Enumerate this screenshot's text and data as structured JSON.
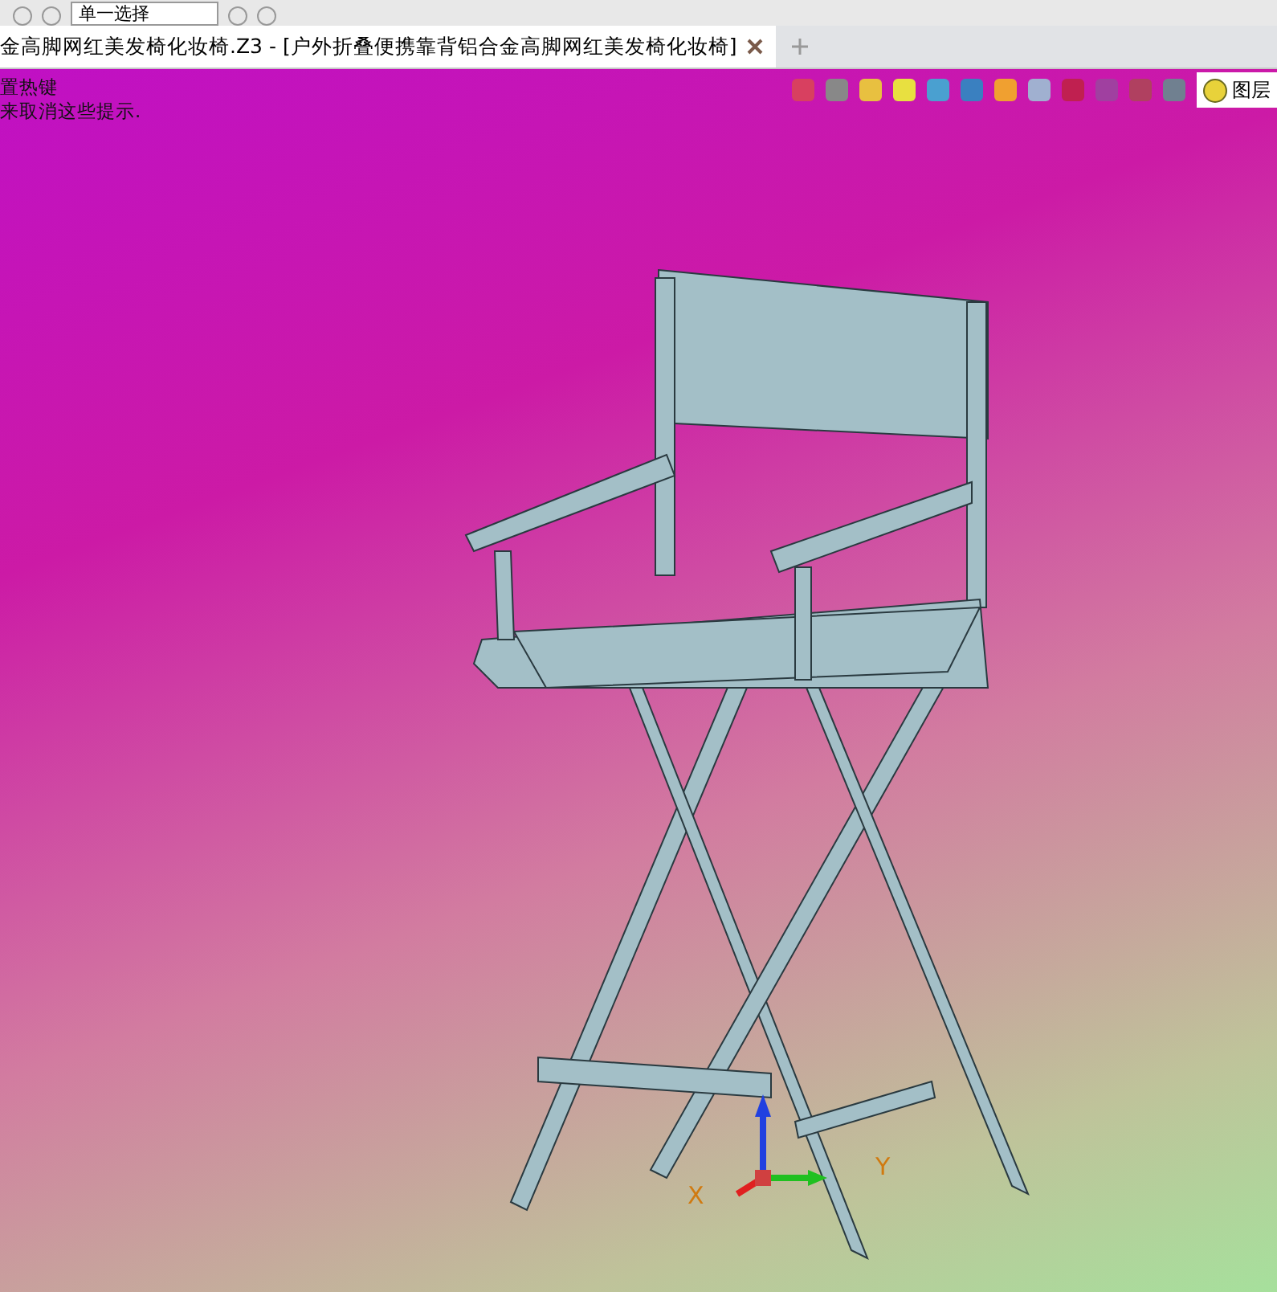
{
  "toolbar": {
    "select_field": {
      "value": "单一选择"
    }
  },
  "tabs": [
    {
      "label": "金高脚网红美发椅化妆椅.Z3 - [户外折叠便携靠背铝合金高脚网红美发椅化妆椅]",
      "selected": true
    }
  ],
  "hints": [
    "置热键",
    "来取消这些提示."
  ],
  "layer_field": {
    "value": "图层"
  },
  "axes": {
    "x_label": "X",
    "y_label": "Y"
  }
}
